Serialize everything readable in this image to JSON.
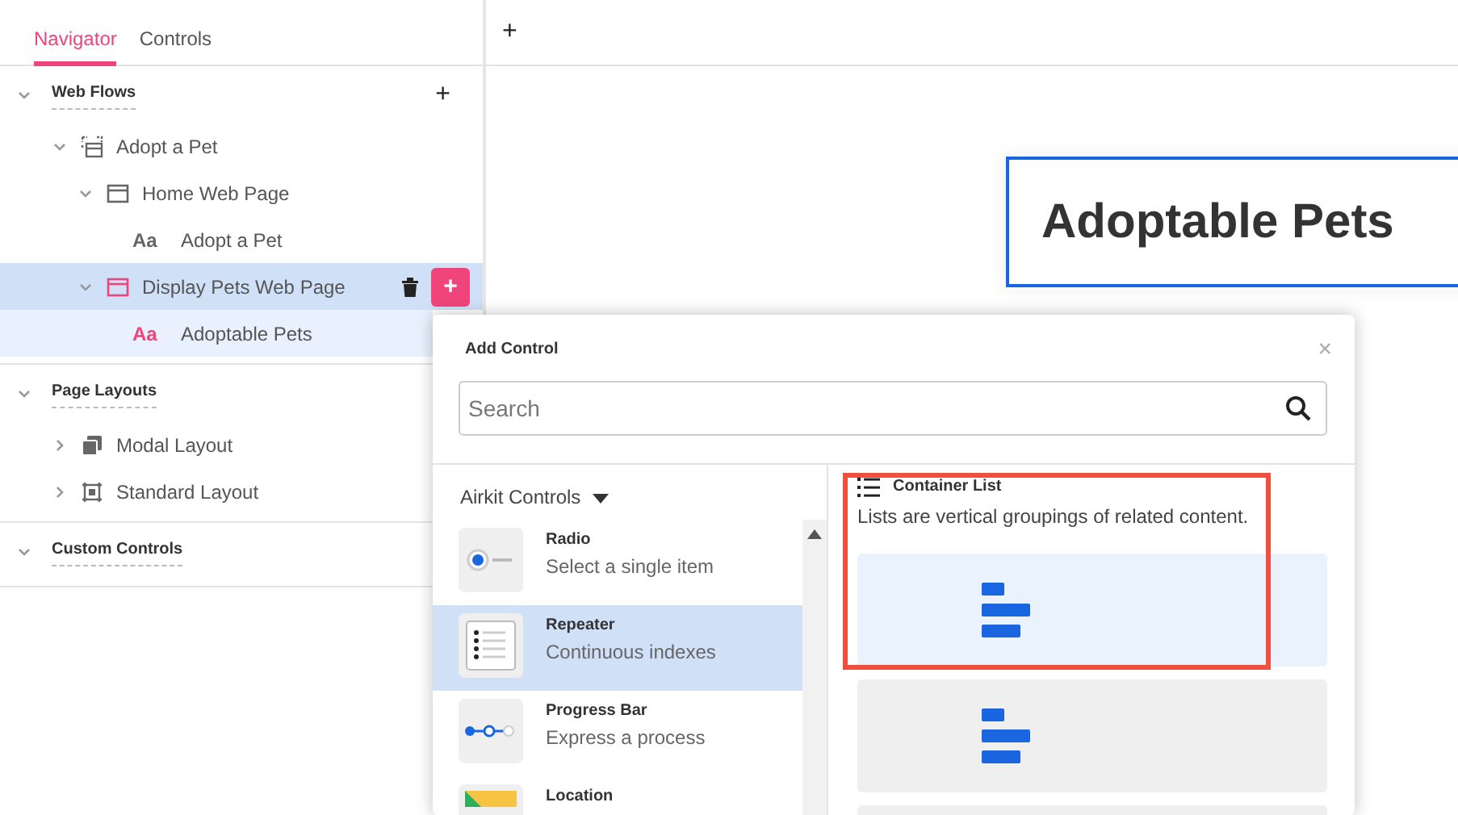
{
  "tabs": [
    {
      "label": "Navigator",
      "selected": true
    },
    {
      "label": "Controls",
      "selected": false
    }
  ],
  "sections": [
    {
      "title": "Web Flows",
      "expanded": true,
      "add": "+",
      "items": [
        {
          "label": "Adopt a Pet",
          "kind": "flow",
          "expanded": true,
          "selected": false,
          "highlighted": false,
          "children": [
            {
              "label": "Home Web Page",
              "kind": "page",
              "expanded": true,
              "selected": false,
              "highlighted": false,
              "children": [
                {
                  "label": "Adopt a Pet",
                  "kind": "text",
                  "icon": "Aa",
                  "selected": false,
                  "highlighted": false
                }
              ]
            },
            {
              "label": "Display Pets Web Page",
              "kind": "page",
              "expanded": true,
              "selected": true,
              "highlighted": true,
              "add": "+",
              "children": [
                {
                  "label": "Adoptable Pets",
                  "kind": "text",
                  "icon": "Aa",
                  "selected": false,
                  "highlighted": true
                }
              ]
            }
          ]
        }
      ]
    },
    {
      "title": "Page Layouts",
      "expanded": true,
      "items": [
        {
          "label": "Modal Layout",
          "kind": "modal",
          "expanded": false,
          "selected": false,
          "highlighted": false
        },
        {
          "label": "Standard Layout",
          "kind": "layout",
          "expanded": false,
          "selected": false,
          "highlighted": false
        }
      ]
    },
    {
      "title": "Custom Controls",
      "expanded": true
    }
  ],
  "canvas": {
    "add": "+",
    "heading": "Adoptable Pets"
  },
  "modal": {
    "title": "Add Control",
    "close": "×",
    "search": {
      "placeholder": "Search"
    },
    "library": "Airkit Controls",
    "controls": [
      {
        "name": "Radio",
        "description": "Select a single item",
        "kind": "radio",
        "selected": false
      },
      {
        "name": "Repeater",
        "description": "Continuous indexes",
        "kind": "repeater",
        "selected": true
      },
      {
        "name": "Progress Bar",
        "description": "Express a process",
        "kind": "progress",
        "selected": false
      },
      {
        "name": "Location",
        "kind": "location",
        "selected": false
      }
    ],
    "preview": {
      "title": "Container List",
      "description": "Lists are vertical groupings of related content.",
      "outlined": true,
      "variants": [
        {
          "selected": true
        },
        {
          "selected": false
        },
        {
          "selected": false
        }
      ]
    }
  }
}
